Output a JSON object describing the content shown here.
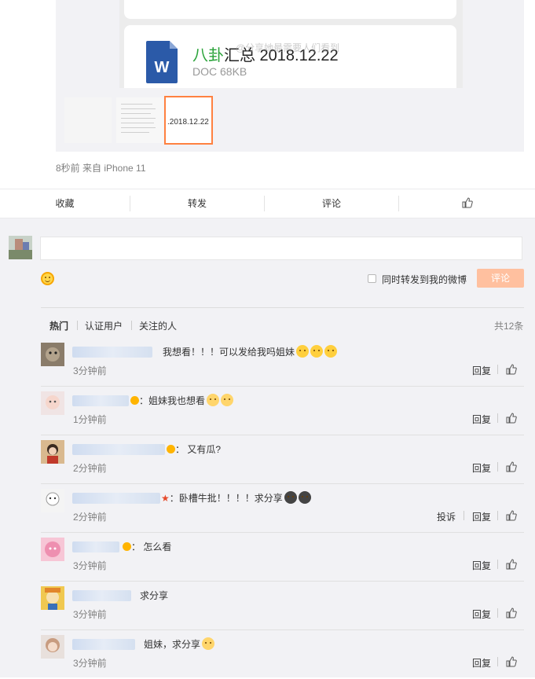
{
  "post": {
    "file_title_highlight": "八卦",
    "file_title_rest": "汇总 2018.12.22",
    "file_meta": "DOC 68KB",
    "doc_icon_letter": "W",
    "watermark": "@分享她最需要人们看到",
    "selected_thumb_text": ".2018.12.22",
    "time_source": "8秒前  来自 iPhone 11"
  },
  "actions": {
    "favorite": "收藏",
    "forward": "转发",
    "comment": "评论",
    "like_icon": "thumbs-up-icon"
  },
  "composer": {
    "input_value": "",
    "forward_label": "同时转发到我的微博",
    "submit_label": "评论",
    "emoji_icon": "smile-icon"
  },
  "filters": {
    "tabs": [
      "热门",
      "认证用户",
      "关注的人"
    ],
    "total": "共12条"
  },
  "comments": [
    {
      "text": "我想看！！！可以发给我吗姐妹",
      "time": "3分钟前",
      "reply": "回复",
      "report": ""
    },
    {
      "text": "：姐妹我也想看",
      "time": "1分钟前",
      "reply": "回复",
      "report": ""
    },
    {
      "text": "： 又有瓜?",
      "time": "2分钟前",
      "reply": "回复",
      "report": ""
    },
    {
      "text": "：卧槽牛批！！！！求分享",
      "time": "2分钟前",
      "reply": "回复",
      "report": "投诉"
    },
    {
      "text": "： 怎么看",
      "time": "3分钟前",
      "reply": "回复",
      "report": ""
    },
    {
      "text": "求分享",
      "time": "3分钟前",
      "reply": "回复",
      "report": ""
    },
    {
      "text": "姐妹，求分享",
      "time": "3分钟前",
      "reply": "回复",
      "report": ""
    }
  ],
  "colors": {
    "accent_orange": "#ff8140",
    "submit_disabled": "#ffc09f",
    "doc_blue": "#2b5aa8",
    "title_green": "#2aa33a"
  }
}
